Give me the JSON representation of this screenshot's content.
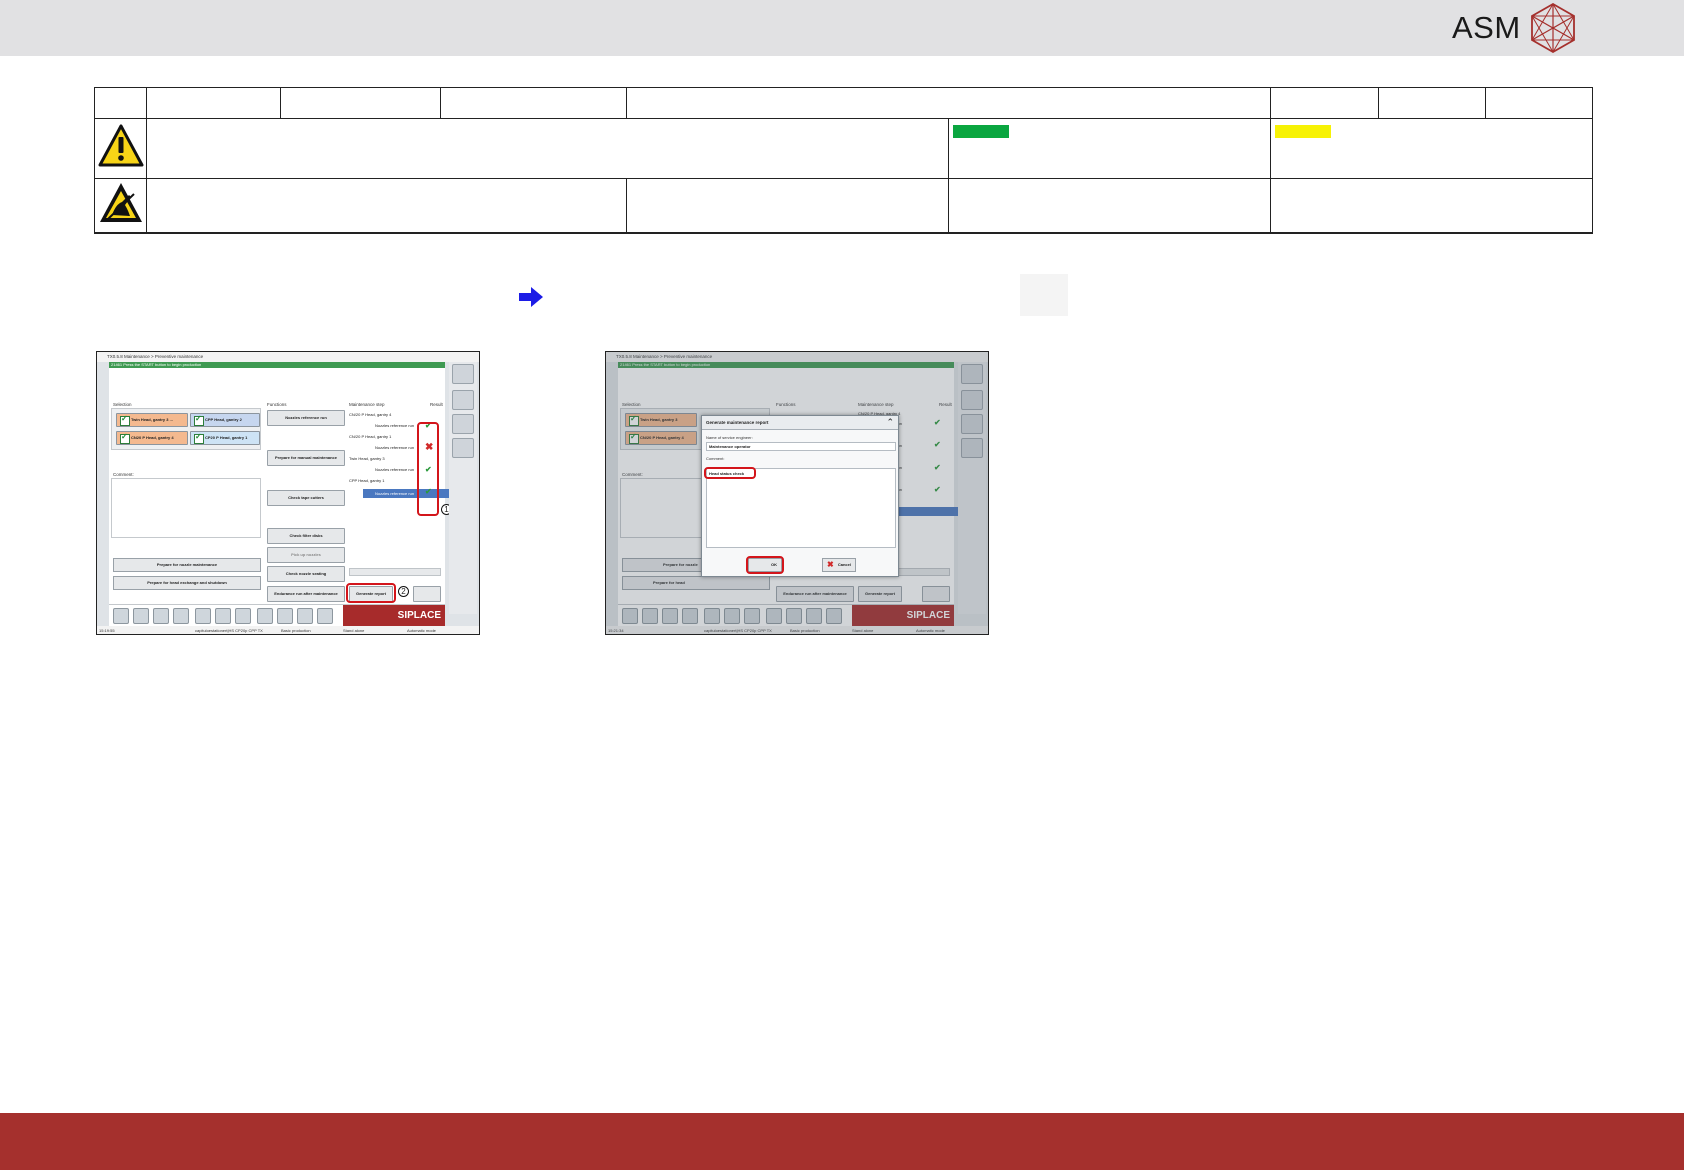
{
  "brand": {
    "name": "ASM"
  },
  "doc_table": {
    "row1_cells": [
      "",
      "",
      "",
      "",
      "",
      "",
      "",
      ""
    ],
    "row2_text": "",
    "row3_text": ""
  },
  "colors": {
    "footer": "#a5302d",
    "status_green": "#0aa640",
    "status_yellow": "#f7f205",
    "highlight": "#d3151b"
  },
  "icons": [
    "warning-triangle-icon",
    "esd-warning-icon",
    "right-arrow-icon"
  ],
  "screenshot1": {
    "title": "TX0.5.8 Maintenance > Preventive maintenance",
    "message": "21461 Press the START button to begin production",
    "selection_label": "Selection",
    "selection_buttons": [
      "Twin Head, gantry 3 ...",
      "CPP Head, gantry 2",
      "CN20 P Head, gantry 4",
      "CP20 P Head, gantry 1"
    ],
    "comment_label": "Comment:",
    "functions_label": "Functions",
    "function_buttons": [
      "Nozzles reference run",
      "Prepare for manual maintenance",
      "Check tape cutters",
      "Check filter disks",
      "Pick up nozzles",
      "Check nozzle seating"
    ],
    "wide_buttons": [
      "Prepare for nozzle maintenance",
      "Prepare for head exchange and shutdown"
    ],
    "endurance_button": "Endurance run after maintenance",
    "generate_button": "Generate report",
    "tree_header": "Maintenance step",
    "result_header": "Result",
    "tree": [
      {
        "label": "CN/20 P Head, gantry 4",
        "indent": false
      },
      {
        "label": "Nozzles reference run",
        "indent": true,
        "result": "ok"
      },
      {
        "label": "CN/20 P Head, gantry 1",
        "indent": false
      },
      {
        "label": "Nozzles reference run",
        "indent": true,
        "result": "fail"
      },
      {
        "label": "Twin Head, gantry 3",
        "indent": false
      },
      {
        "label": "Nozzles reference run",
        "indent": true,
        "result": "ok"
      },
      {
        "label": "CPP Head, gantry 1",
        "indent": false
      },
      {
        "label": "Nozzles reference run",
        "indent": true,
        "result": "ok",
        "selected": true
      }
    ],
    "callouts": [
      "1",
      "2"
    ],
    "brand_bar": "SIPLACE",
    "status": {
      "time": "15:19:55",
      "station": "capituloestationert|HS CP20p CPP TX",
      "mode1": "Basic production",
      "mode2": "Stand alone",
      "mode3": "Automatic mode"
    }
  },
  "screenshot2": {
    "title": "TX0.5.8 Maintenance > Preventive maintenance",
    "message": "21461 Press the START button to begin production",
    "selection_label": "Selection",
    "selection_buttons": [
      "Twin Head, gantry 3",
      "CN/20 P Head, gantry 4"
    ],
    "comment_label": "Comment:",
    "functions_label": "Functions",
    "tree_header": "Maintenance step",
    "result_header": "Result",
    "tree_visible": [
      "CN/20 P Head, gantry 4",
      "ice run",
      "try 1",
      "ice run",
      "ice run",
      "ice run",
      "ice run"
    ],
    "partial_buttons": [
      "Prepare for nozzle",
      "Prepare for head"
    ],
    "endurance_button": "Endurance run after maintenance",
    "generate_button": "Generate report",
    "dialog": {
      "title": "Generate maintenance report",
      "engineer_label": "Name of service engineer:",
      "engineer_value": "Maintenance operator",
      "comment_label": "Comment:",
      "comment_value": "Head status check",
      "ok_label": "OK",
      "cancel_label": "Cancel"
    },
    "brand_bar": "SIPLACE",
    "status": {
      "time": "15:21:34",
      "station": "capituloestationert|HS CP20p CPP TX",
      "mode1": "Basic production",
      "mode2": "Stand alone",
      "mode3": "Automatic mode"
    }
  }
}
